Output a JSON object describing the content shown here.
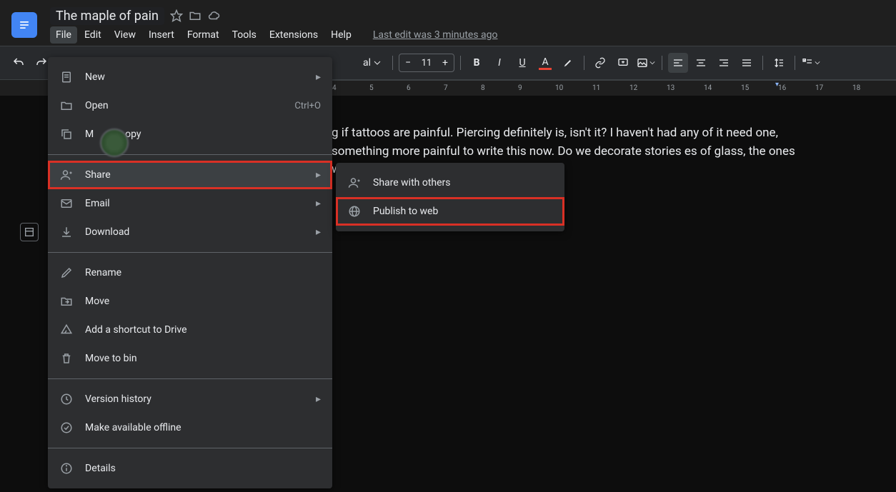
{
  "header": {
    "doc_title": "The maple of pain",
    "last_edit": "Last edit was 3 minutes ago"
  },
  "menubar": {
    "file": "File",
    "edit": "Edit",
    "view": "View",
    "insert": "Insert",
    "format": "Format",
    "tools": "Tools",
    "extensions": "Extensions",
    "help": "Help"
  },
  "toolbar": {
    "font_size": "11"
  },
  "ruler": {
    "ticks": [
      "4",
      "5",
      "6",
      "7",
      "8",
      "9",
      "10",
      "11",
      "12",
      "13",
      "14",
      "15",
      "16",
      "17",
      "18"
    ]
  },
  "file_menu": {
    "new": "New",
    "open": "Open",
    "open_shortcut": "Ctrl+O",
    "make_copy": "Make a copy",
    "share": "Share",
    "email": "Email",
    "download": "Download",
    "rename": "Rename",
    "move": "Move",
    "add_shortcut": "Add a shortcut to Drive",
    "move_to_bin": "Move to bin",
    "version_history": "Version history",
    "available_offline": "Make available offline",
    "details": "Details"
  },
  "share_submenu": {
    "share_others": "Share with others",
    "publish_web": "Publish to web"
  },
  "document": {
    "text": "g if tattoos are painful. Piercing definitely is, isn't it? I haven't had any of it need one, something more painful to write this now. Do we decorate stories es of glass, the ones with stains of blood?"
  }
}
